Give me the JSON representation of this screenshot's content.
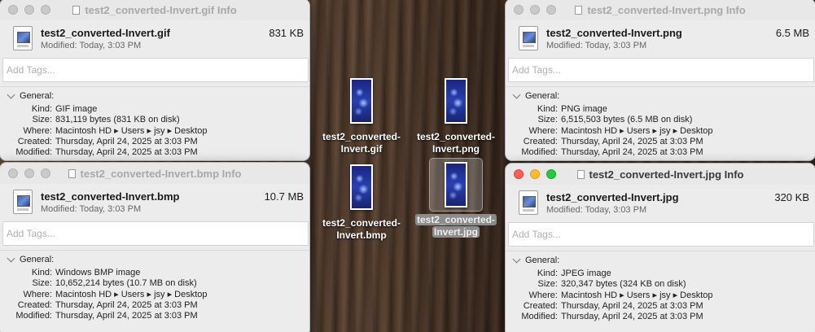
{
  "desktop": {
    "icons": [
      {
        "label_line1": "test2_converted-",
        "label_line2": "Invert.gif",
        "selected": false
      },
      {
        "label_line1": "test2_converted-",
        "label_line2": "Invert.png",
        "selected": false
      },
      {
        "label_line1": "test2_converted-",
        "label_line2": "Invert.bmp",
        "selected": false
      },
      {
        "label_line1": "test2_converted-",
        "label_line2": "Invert.jpg",
        "selected": true
      }
    ]
  },
  "windows": {
    "gif": {
      "title": "test2_converted-Invert.gif Info",
      "name": "test2_converted-Invert.gif",
      "modified": "Modified: Today, 3:03 PM",
      "size": "831 KB",
      "tags_placeholder": "Add Tags...",
      "section": "General:",
      "rows": [
        {
          "k": "Kind:",
          "v": "GIF image"
        },
        {
          "k": "Size:",
          "v": "831,119 bytes (831 KB on disk)"
        },
        {
          "k": "Where:",
          "v": "Macintosh HD ▸ Users ▸ jsy ▸ Desktop"
        },
        {
          "k": "Created:",
          "v": "Thursday, April 24, 2025 at 3:03 PM"
        },
        {
          "k": "Modified:",
          "v": "Thursday, April 24, 2025 at 3:03 PM"
        }
      ]
    },
    "png": {
      "title": "test2_converted-Invert.png Info",
      "name": "test2_converted-Invert.png",
      "modified": "Modified: Today, 3:03 PM",
      "size": "6.5 MB",
      "tags_placeholder": "Add Tags...",
      "section": "General:",
      "rows": [
        {
          "k": "Kind:",
          "v": "PNG image"
        },
        {
          "k": "Size:",
          "v": "6,515,503 bytes (6.5 MB on disk)"
        },
        {
          "k": "Where:",
          "v": "Macintosh HD ▸ Users ▸ jsy ▸ Desktop"
        },
        {
          "k": "Created:",
          "v": "Thursday, April 24, 2025 at 3:03 PM"
        },
        {
          "k": "Modified:",
          "v": "Thursday, April 24, 2025 at 3:03 PM"
        }
      ]
    },
    "bmp": {
      "title": "test2_converted-Invert.bmp Info",
      "name": "test2_converted-Invert.bmp",
      "modified": "Modified: Today, 3:03 PM",
      "size": "10.7 MB",
      "tags_placeholder": "Add Tags...",
      "section": "General:",
      "rows": [
        {
          "k": "Kind:",
          "v": "Windows BMP image"
        },
        {
          "k": "Size:",
          "v": "10,652,214 bytes (10.7 MB on disk)"
        },
        {
          "k": "Where:",
          "v": "Macintosh HD ▸ Users ▸ jsy ▸ Desktop"
        },
        {
          "k": "Created:",
          "v": "Thursday, April 24, 2025 at 3:03 PM"
        },
        {
          "k": "Modified:",
          "v": "Thursday, April 24, 2025 at 3:03 PM"
        }
      ]
    },
    "jpg": {
      "title": "test2_converted-Invert.jpg Info",
      "name": "test2_converted-Invert.jpg",
      "modified": "Modified: Today, 3:03 PM",
      "size": "320 KB",
      "tags_placeholder": "Add Tags...",
      "section": "General:",
      "rows": [
        {
          "k": "Kind:",
          "v": "JPEG image"
        },
        {
          "k": "Size:",
          "v": "320,347 bytes (324 KB on disk)"
        },
        {
          "k": "Where:",
          "v": "Macintosh HD ▸ Users ▸ jsy ▸ Desktop"
        },
        {
          "k": "Created:",
          "v": "Thursday, April 24, 2025 at 3:03 PM"
        },
        {
          "k": "Modified:",
          "v": "Thursday, April 24, 2025 at 3:03 PM"
        }
      ]
    }
  },
  "colors": {
    "close": "#fe5f57",
    "minimize": "#febc2e",
    "zoom": "#28c840",
    "selection": "#8c8c8c"
  }
}
